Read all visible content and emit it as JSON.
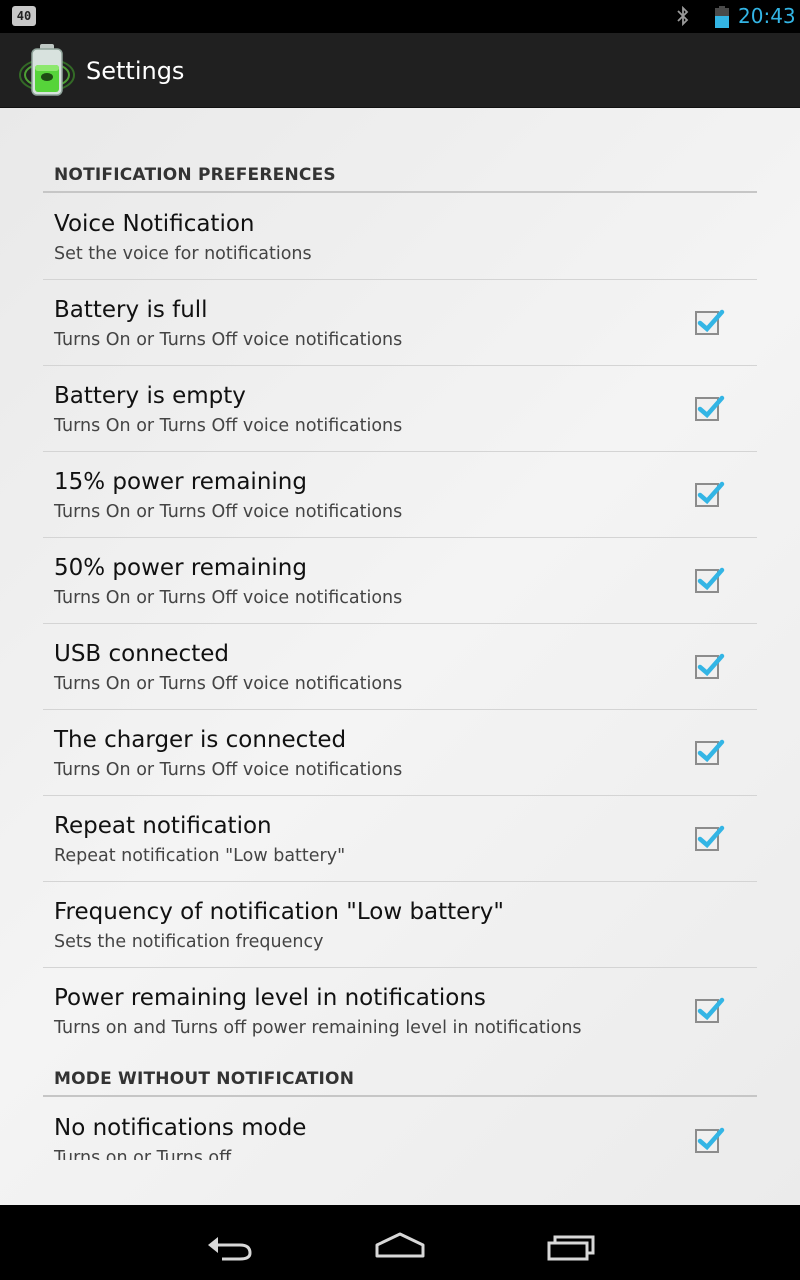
{
  "status_bar": {
    "notification_badge": "40",
    "time": "20:43",
    "icons": [
      "bluetooth-icon",
      "battery-icon"
    ],
    "accent": "#33b5e5"
  },
  "action_bar": {
    "title": "Settings",
    "icon": "battery-app-icon"
  },
  "categories": [
    {
      "label": "NOTIFICATION PREFERENCES"
    },
    {
      "label": "MODE WITHOUT NOTIFICATION"
    }
  ],
  "preferences": [
    {
      "title": "Voice Notification",
      "summary": "Set the voice for notifications",
      "has_checkbox": false,
      "checked": false
    },
    {
      "title": "Battery is full",
      "summary": "Turns On or Turns Off voice notifications",
      "has_checkbox": true,
      "checked": true
    },
    {
      "title": "Battery is empty",
      "summary": "Turns On or Turns Off voice notifications",
      "has_checkbox": true,
      "checked": true
    },
    {
      "title": "15% power remaining",
      "summary": "Turns On or Turns Off voice notifications",
      "has_checkbox": true,
      "checked": true
    },
    {
      "title": "50% power remaining",
      "summary": "Turns On or Turns Off voice notifications",
      "has_checkbox": true,
      "checked": true
    },
    {
      "title": "USB connected",
      "summary": "Turns On or Turns Off voice notifications",
      "has_checkbox": true,
      "checked": true
    },
    {
      "title": "The charger is connected",
      "summary": "Turns On or Turns Off voice notifications",
      "has_checkbox": true,
      "checked": true
    },
    {
      "title": "Repeat notification",
      "summary": "Repeat notification \"Low battery\"",
      "has_checkbox": true,
      "checked": true
    },
    {
      "title": "Frequency of notification \"Low battery\"",
      "summary": "Sets the notification frequency",
      "has_checkbox": false,
      "checked": false
    },
    {
      "title": "Power remaining level in notifications",
      "summary": "Turns on and Turns off power remaining level in notifications",
      "has_checkbox": true,
      "checked": true
    },
    {
      "title": "No notifications mode",
      "summary": "Turns on or Turns off",
      "has_checkbox": true,
      "checked": true
    }
  ],
  "nav_bar": {
    "buttons": [
      "back-icon",
      "home-icon",
      "recents-icon"
    ]
  },
  "colors": {
    "check": "#33b5e5",
    "action_bar": "#202020",
    "background": "#eeeeee"
  }
}
